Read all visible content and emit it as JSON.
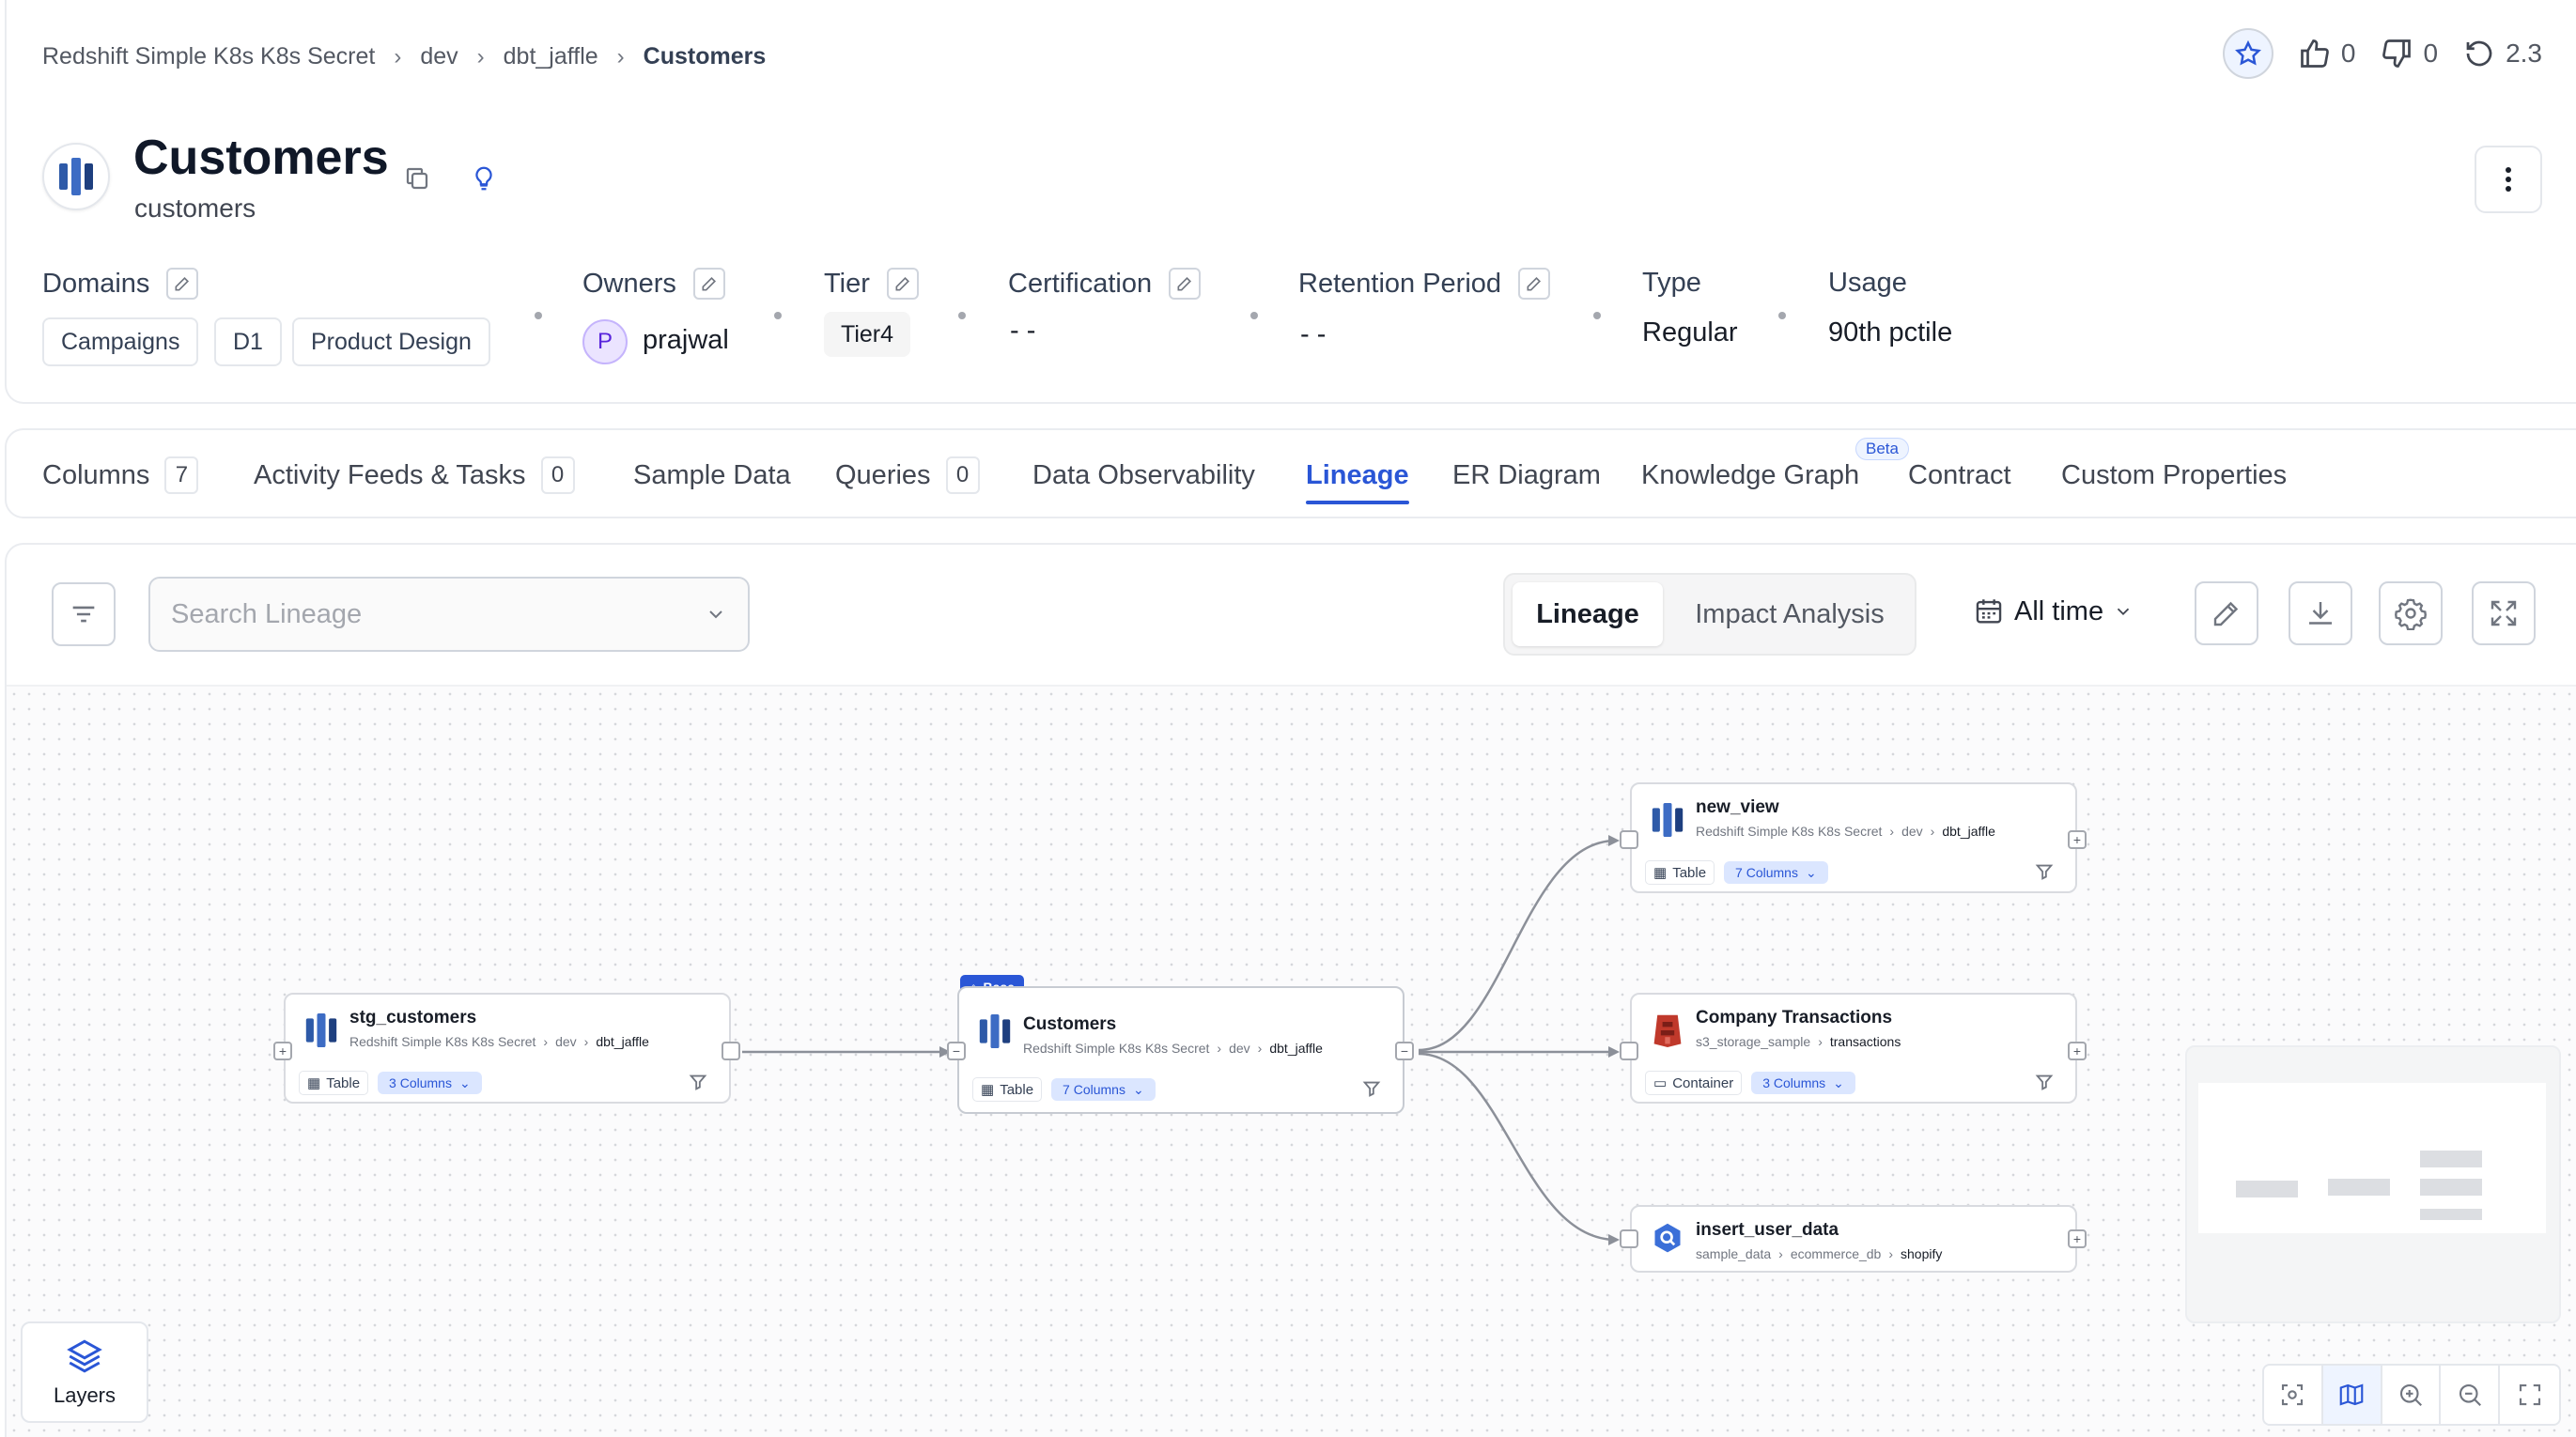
{
  "breadcrumb": [
    "Redshift Simple K8s K8s Secret",
    "dev",
    "dbt_jaffle",
    "Customers"
  ],
  "header_actions": {
    "likes": "0",
    "dislikes": "0",
    "version": "2.3"
  },
  "entity": {
    "title": "Customers",
    "subtitle": "customers",
    "icon": "redshift-icon"
  },
  "meta": {
    "domains": {
      "label": "Domains",
      "items": [
        "Campaigns",
        "D1",
        "Product Design"
      ]
    },
    "owners": {
      "label": "Owners",
      "avatar_letter": "P",
      "name": "prajwal"
    },
    "tier": {
      "label": "Tier",
      "value": "Tier4"
    },
    "certification": {
      "label": "Certification",
      "value": "- -"
    },
    "retention": {
      "label": "Retention Period",
      "value": "- -"
    },
    "type": {
      "label": "Type",
      "value": "Regular"
    },
    "usage": {
      "label": "Usage",
      "value": "90th pctile"
    }
  },
  "tabs": [
    {
      "label": "Columns",
      "count": "7"
    },
    {
      "label": "Activity Feeds & Tasks",
      "count": "0"
    },
    {
      "label": "Sample Data"
    },
    {
      "label": "Queries",
      "count": "0"
    },
    {
      "label": "Data Observability"
    },
    {
      "label": "Lineage",
      "active": true
    },
    {
      "label": "ER Diagram"
    },
    {
      "label": "Knowledge Graph",
      "badge": "Beta"
    },
    {
      "label": "Contract"
    },
    {
      "label": "Custom Properties"
    }
  ],
  "lineage_toolbar": {
    "search_placeholder": "Search Lineage",
    "mode_lineage": "Lineage",
    "mode_impact": "Impact Analysis",
    "time_filter": "All time"
  },
  "nodes": {
    "stg_customers": {
      "name": "stg_customers",
      "path": [
        "Redshift Simple K8s K8s Secret",
        "dev",
        "dbt_jaffle"
      ],
      "type": "Table",
      "columns": "3 Columns"
    },
    "customers": {
      "badge": "Base",
      "name": "Customers",
      "path": [
        "Redshift Simple K8s K8s Secret",
        "dev",
        "dbt_jaffle"
      ],
      "type": "Table",
      "columns": "7 Columns"
    },
    "new_view": {
      "name": "new_view",
      "path": [
        "Redshift Simple K8s K8s Secret",
        "dev",
        "dbt_jaffle"
      ],
      "type": "Table",
      "columns": "7 Columns"
    },
    "company_transactions": {
      "name": "Company Transactions",
      "path": [
        "s3_storage_sample",
        "transactions"
      ],
      "type": "Container",
      "columns": "3 Columns"
    },
    "insert_user_data": {
      "name": "insert_user_data",
      "path": [
        "sample_data",
        "ecommerce_db",
        "shopify"
      ]
    }
  },
  "layers_label": "Layers",
  "colors": {
    "accent": "#2a56d6",
    "redshift": "#2e5aa8",
    "s3": "#c0392b",
    "query": "#3b6fd8"
  }
}
